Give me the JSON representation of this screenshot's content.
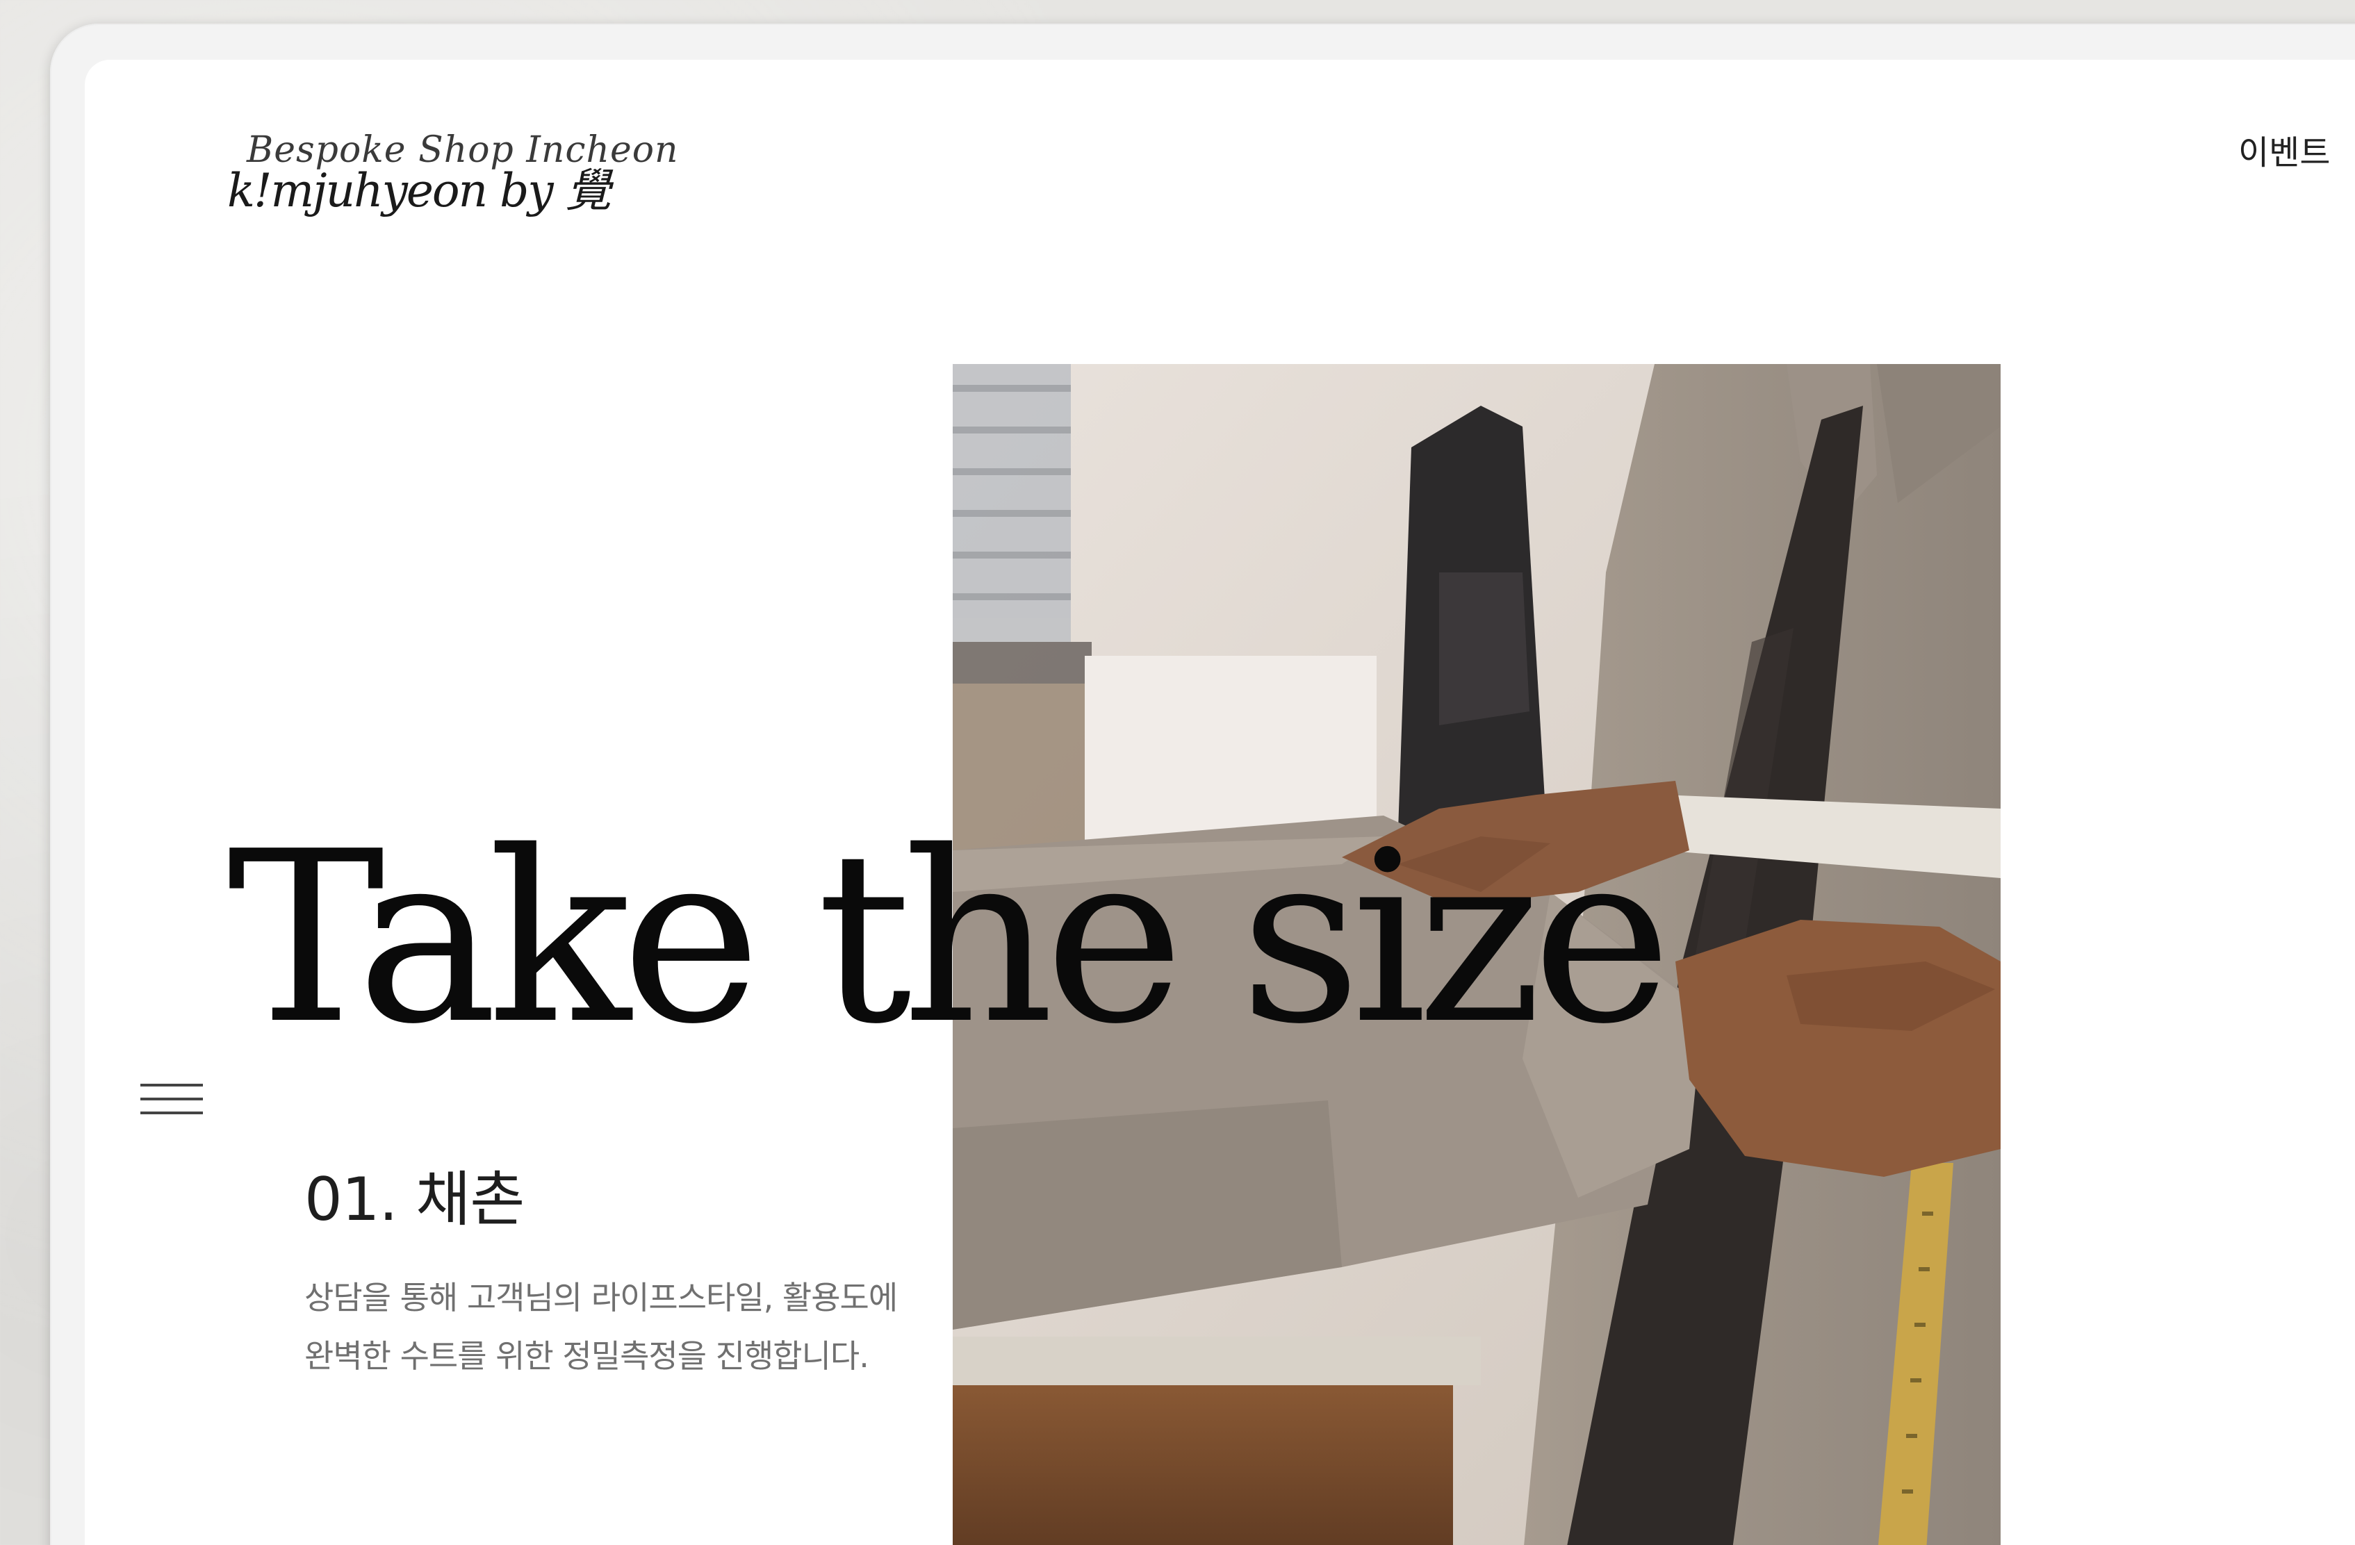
{
  "logo": {
    "script_text": "Bespoke Shop Incheon",
    "main_text": "k!mjuhyeon by 覺"
  },
  "nav": {
    "event_label": "이벤트"
  },
  "hero": {
    "heading": "Take the size",
    "step_title": "01. 채촌",
    "step_description_line1": "상담을 통해 고객님의 라이프스타일, 활용도에",
    "step_description_line2": "완벽한 수트를 위한 정밀측정을 진행합니다.",
    "photo_alt": "tailor measuring chest with tape"
  },
  "colors": {
    "background": "#e6e5e2",
    "screen": "#ffffff",
    "heading": "#0a0a0a",
    "body_text": "#707070"
  },
  "icons": {
    "menu": "hamburger-menu-icon"
  }
}
